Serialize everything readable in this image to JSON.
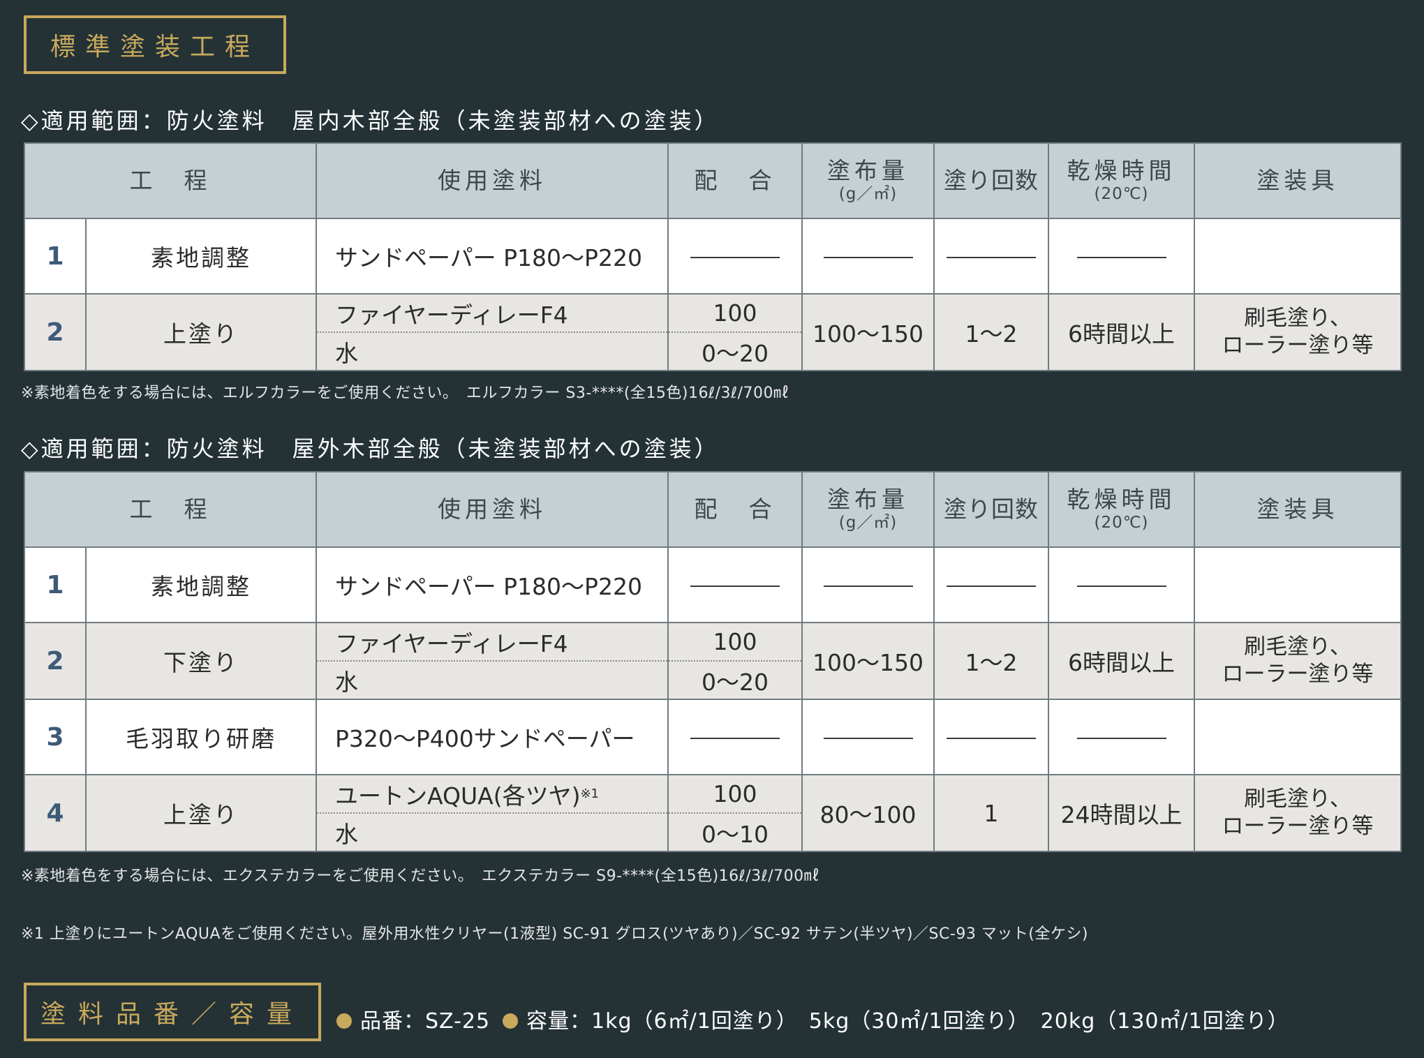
{
  "title_box": "標準塗装工程",
  "table_headers": {
    "process": "工　程",
    "paint": "使用塗料",
    "mix": "配　合",
    "coverage": "塗布量",
    "coverage_unit": "(g／㎡)",
    "coats": "塗り回数",
    "drying": "乾燥時間",
    "drying_unit": "(20℃)",
    "tools": "塗装具"
  },
  "section1": {
    "heading": "◇適用範囲：防火塗料　屋内木部全般（未塗装部材への塗装）",
    "rows": [
      {
        "no": "1",
        "process": "素地調整",
        "paint": "サンドペーパー P180〜P220",
        "tools": ""
      },
      {
        "no": "2",
        "process": "上塗り",
        "paint1": "ファイヤーディレーF4",
        "paint2": "水",
        "mix1": "100",
        "mix2": "0〜20",
        "coverage": "100〜150",
        "coats": "1〜2",
        "drying": "6時間以上",
        "tools1": "刷毛塗り、",
        "tools2": "ローラー塗り等"
      }
    ],
    "note": "※素地着色をする場合には、エルフカラーをご使用ください。　エルフカラー S3-****(全15色)16ℓ/3ℓ/700㎖"
  },
  "section2": {
    "heading": "◇適用範囲：防火塗料　屋外木部全般（未塗装部材への塗装）",
    "rows": [
      {
        "no": "1",
        "process": "素地調整",
        "paint": "サンドペーパー P180〜P220"
      },
      {
        "no": "2",
        "process": "下塗り",
        "paint1": "ファイヤーディレーF4",
        "paint2": "水",
        "mix1": "100",
        "mix2": "0〜20",
        "coverage": "100〜150",
        "coats": "1〜2",
        "drying": "6時間以上",
        "tools1": "刷毛塗り、",
        "tools2": "ローラー塗り等"
      },
      {
        "no": "3",
        "process": "毛羽取り研磨",
        "paint": "P320〜P400サンドペーパー"
      },
      {
        "no": "4",
        "process": "上塗り",
        "paint1": "ユートンAQUA(各ツヤ)",
        "paint1_sup": "※1",
        "paint2": "水",
        "mix1": "100",
        "mix2": "0〜10",
        "coverage": "80〜100",
        "coats": "1",
        "drying": "24時間以上",
        "tools1": "刷毛塗り、",
        "tools2": "ローラー塗り等"
      }
    ],
    "note": "※素地着色をする場合には、エクステカラーをご使用ください。　エクステカラー S9-****(全15色)16ℓ/3ℓ/700㎖"
  },
  "footnote": "※1 上塗りにユートンAQUAをご使用ください。屋外用水性クリヤー(1液型) SC-91 グロス(ツヤあり)／SC-92 サテン(半ツヤ)／SC-93 マット(全ケシ)",
  "product_box": "塗料品番／容量",
  "product_code": "品番：SZ-25",
  "capacity": "容量：1kg（6㎡/1回塗り）　5kg（30㎡/1回塗り）　20kg（130㎡/1回塗り）",
  "colors": {
    "gold": "#c9a95c",
    "background": "#243236",
    "header": "#c6cfd4"
  }
}
